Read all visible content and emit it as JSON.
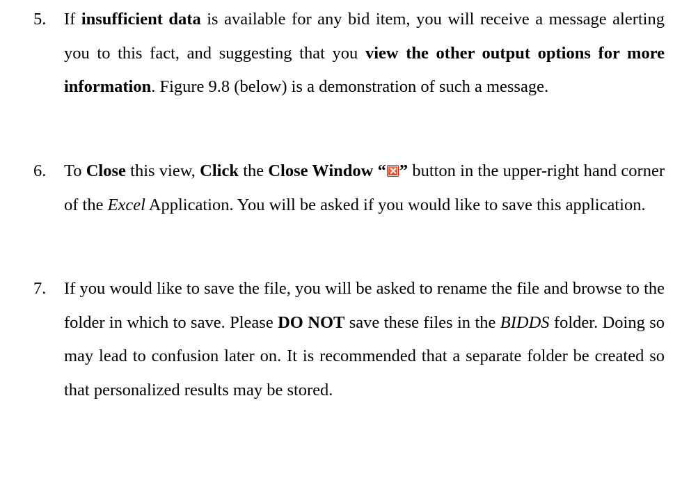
{
  "items": [
    {
      "number": "5.",
      "t1": "If ",
      "b1": "insufficient data",
      "t2": " is available for any bid item, you will receive a message alerting you to this fact, and suggesting that you ",
      "b2": "view the other output options for more information",
      "t3": ".  Figure 9.8 (below) is a demonstration of such a message."
    },
    {
      "number": "6.",
      "t1": "To ",
      "b1": "Close",
      "t2": " this view, ",
      "b2": "Click",
      "t3": " the ",
      "b3": "Close Window “",
      "icon": "close-window-icon",
      "b4": "”",
      "t4": " button in the upper-right hand corner of the ",
      "i1": "Excel",
      "t5": " Application.  You will be asked if you would like to save this application."
    },
    {
      "number": "7.",
      "t1": "If you would like to save the file, you will be asked to rename the file and browse to the folder in which to save.  Please ",
      "b1": "DO NOT",
      "t2": " save these files in the ",
      "i1": "BIDDS",
      "t3": " folder.  Doing so may lead to confusion later on.  It is recommended that a separate folder be created so that personalized results may be stored."
    }
  ]
}
